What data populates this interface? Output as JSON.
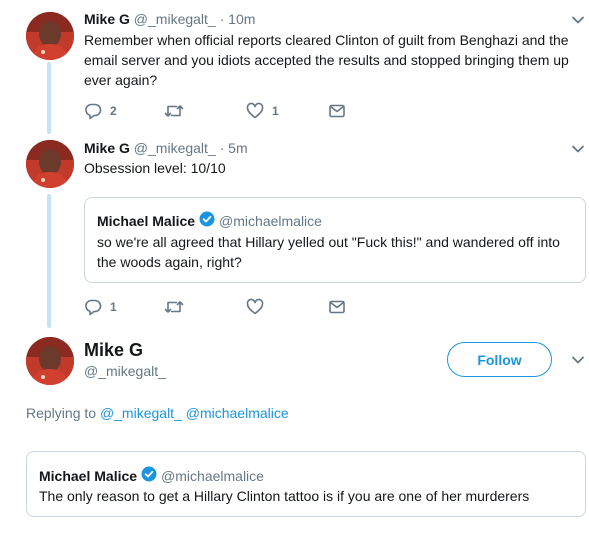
{
  "tweets": [
    {
      "name": "Mike G",
      "handle": "@_mikegalt_",
      "separator": "·",
      "time": "10m",
      "text": "Remember when official reports cleared Clinton of guilt from Benghazi and the email server and you idiots accepted the results and stopped bringing them up ever again?",
      "actions": {
        "reply_count": "2",
        "retweet_count": "",
        "like_count": "1"
      }
    },
    {
      "name": "Mike G",
      "handle": "@_mikegalt_",
      "separator": "·",
      "time": "5m",
      "text": "Obsession level: 10/10",
      "quote": {
        "name": "Michael Malice",
        "handle": "@michaelmalice",
        "text": "so we're all agreed that Hillary yelled out \"Fuck this!\" and wandered off into the woods again, right?"
      },
      "actions": {
        "reply_count": "1",
        "retweet_count": "",
        "like_count": ""
      }
    }
  ],
  "focused": {
    "name": "Mike G",
    "handle": "@_mikegalt_",
    "follow_label": "Follow",
    "replying_prefix": "Replying to",
    "replying_to": [
      "@_mikegalt_",
      "@michaelmalice"
    ],
    "quote": {
      "name": "Michael Malice",
      "handle": "@michaelmalice",
      "text": "The only reason to get a Hillary Clinton tattoo is if you are one of her murderers"
    }
  },
  "icons": {
    "reply": "reply-icon",
    "retweet": "retweet-icon",
    "like": "heart-icon",
    "dm": "envelope-icon",
    "more": "chevron-down-icon",
    "verified": "verified-badge-icon"
  },
  "colors": {
    "accent": "#1b95e0",
    "muted": "#657786",
    "thread_line": "#c4e4f4",
    "border": "#ccd6dd",
    "text": "#14171a"
  }
}
